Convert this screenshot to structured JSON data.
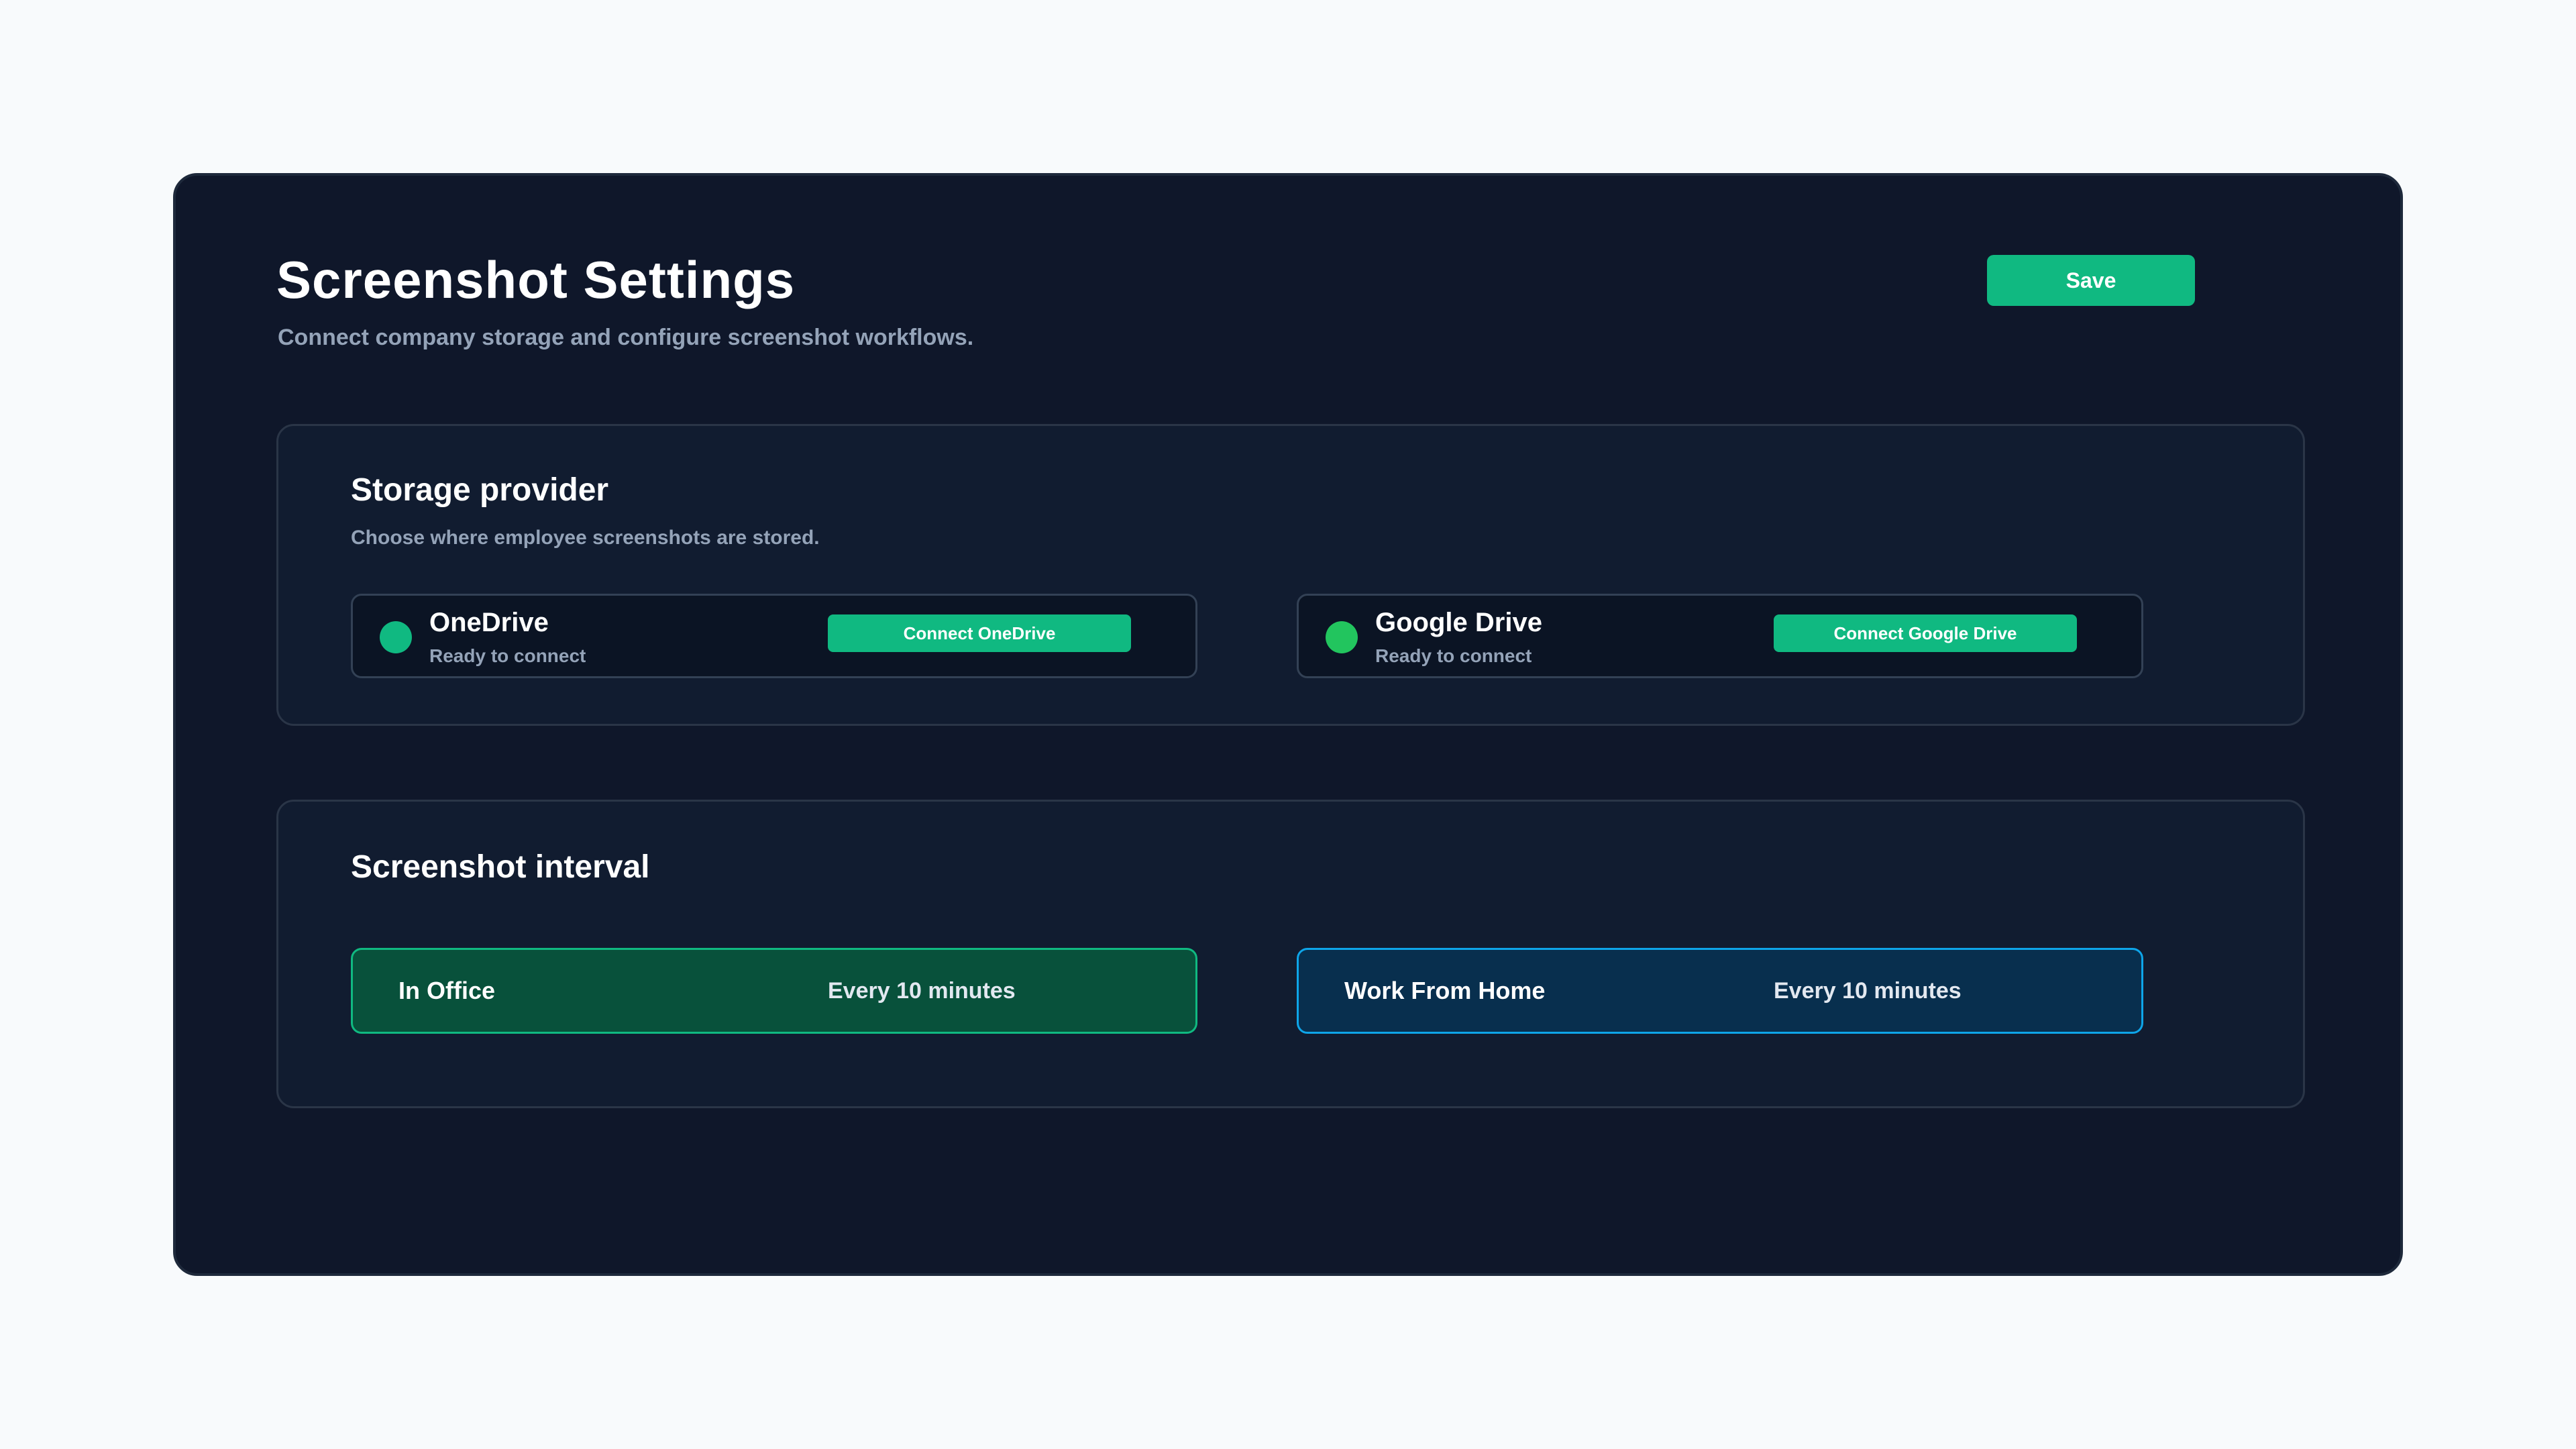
{
  "header": {
    "title": "Screenshot Settings",
    "subtitle": "Connect company storage and configure screenshot workflows.",
    "save_label": "Save"
  },
  "storage": {
    "title": "Storage provider",
    "subtitle": "Choose where employee screenshots are stored.",
    "providers": [
      {
        "name": "OneDrive",
        "status": "Ready to connect",
        "button": "Connect OneDrive",
        "dot_color": "#10b981"
      },
      {
        "name": "Google Drive",
        "status": "Ready to connect",
        "button": "Connect Google Drive",
        "dot_color": "#22c55e"
      }
    ]
  },
  "interval": {
    "title": "Screenshot interval",
    "rows": [
      {
        "label": "In Office",
        "value": "Every 10 minutes",
        "accent": "#10b981"
      },
      {
        "label": "Work From Home",
        "value": "Every 10 minutes",
        "accent": "#0ea5e9"
      }
    ]
  },
  "colors": {
    "background": "#f8fafc",
    "panel": "#0f172a",
    "primary_button": "#10b981"
  }
}
